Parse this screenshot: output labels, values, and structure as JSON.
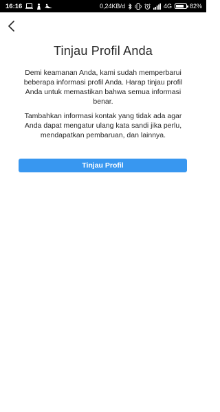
{
  "status_bar": {
    "time": "16:16",
    "network_speed": "0,24KB/d",
    "network_type": "4G",
    "battery_percent": "82%",
    "battery_level": 0.82,
    "icons": [
      "laptop-icon",
      "person-icon",
      "bird-icon",
      "bluetooth-icon",
      "vibrate-icon",
      "alarm-icon",
      "signal-icon",
      "battery-icon"
    ]
  },
  "header": {
    "back_icon": "chevron-left-icon"
  },
  "main": {
    "title": "Tinjau Profil Anda",
    "paragraph_1": "Demi keamanan Anda, kami sudah memperbarui beberapa informasi profil Anda. Harap tinjau profil Anda untuk memastikan bahwa semua informasi benar.",
    "paragraph_2": "Tambahkan informasi kontak yang tidak ada agar Anda dapat mengatur ulang kata sandi jika perlu, mendapatkan pembaruan, dan lainnya.",
    "review_button_label": "Tinjau Profil"
  },
  "colors": {
    "primary_button": "#3897f0",
    "status_bar_bg": "#000000",
    "text": "#262626"
  }
}
